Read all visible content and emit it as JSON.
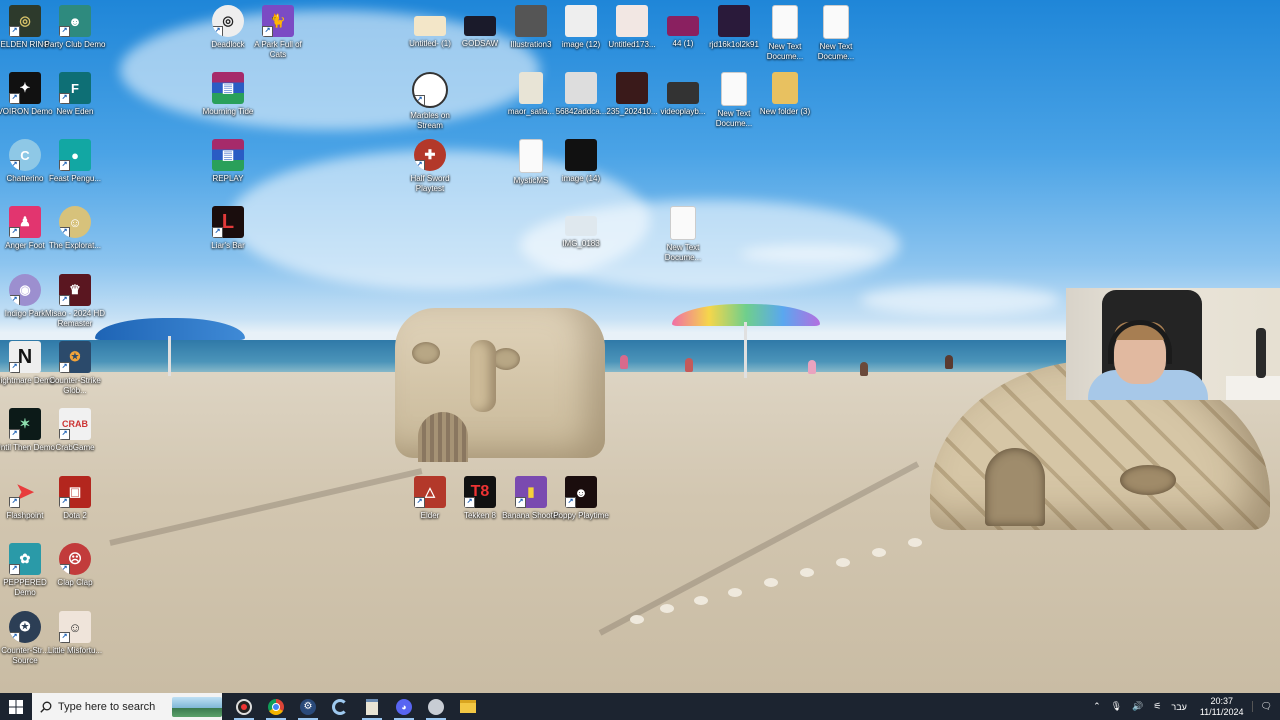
{
  "desktop": {
    "icons": [
      {
        "label": "ELDEN RING",
        "icon": "elden-ring-icon"
      },
      {
        "label": "Party Club Demo",
        "icon": "party-club-icon"
      },
      {
        "label": "VOIRON Demo",
        "icon": "voiron-icon"
      },
      {
        "label": "New Eden",
        "icon": "new-eden-icon"
      },
      {
        "label": "Chatterino",
        "icon": "chatterino-icon"
      },
      {
        "label": "Feast Pengu...",
        "icon": "feast-penguin-icon"
      },
      {
        "label": "Anger Foot",
        "icon": "anger-foot-icon"
      },
      {
        "label": "The Explorat...",
        "icon": "exploration-icon"
      },
      {
        "label": "Indigo Park",
        "icon": "indigo-park-icon"
      },
      {
        "label": "Misao - 2024 HD Remaster",
        "icon": "misao-icon"
      },
      {
        "label": "Nightmare Demo",
        "icon": "nightmare-demo-icon"
      },
      {
        "label": "Counter-Strike Glob...",
        "icon": "counter-strike-go-icon"
      },
      {
        "label": "Until Then Demo",
        "icon": "until-then-icon"
      },
      {
        "label": "CrabGame",
        "icon": "crab-game-icon"
      },
      {
        "label": "Flashpoint",
        "icon": "flashpoint-icon"
      },
      {
        "label": "Dota 2",
        "icon": "dota2-icon"
      },
      {
        "label": "PEPPERED Demo",
        "icon": "peppered-icon"
      },
      {
        "label": "Clap Clap",
        "icon": "clap-clap-icon"
      },
      {
        "label": "Counter-Str... Source",
        "icon": "counter-strike-source-icon"
      },
      {
        "label": "Little Misfortu...",
        "icon": "little-misfortune-icon"
      },
      {
        "label": "Deadlock",
        "icon": "deadlock-icon"
      },
      {
        "label": "A Park Full of Cats",
        "icon": "park-full-of-cats-icon"
      },
      {
        "label": "Mourning Tide",
        "icon": "winrar-archive-icon"
      },
      {
        "label": "REPLAY",
        "icon": "winrar-archive-icon"
      },
      {
        "label": "Liar's Bar",
        "icon": "liars-bar-icon"
      },
      {
        "label": "Untitled- (1)",
        "icon": "image-file-icon"
      },
      {
        "label": "GODSAW",
        "icon": "image-file-icon"
      },
      {
        "label": "Illustration3",
        "icon": "image-file-icon"
      },
      {
        "label": "image (12)",
        "icon": "image-file-icon"
      },
      {
        "label": "Untitled173...",
        "icon": "image-file-icon"
      },
      {
        "label": "44 (1)",
        "icon": "image-file-icon"
      },
      {
        "label": "rjd16k1ol2k91",
        "icon": "image-file-icon"
      },
      {
        "label": "New Text Docume...",
        "icon": "text-document-icon"
      },
      {
        "label": "New Text Docume...",
        "icon": "text-document-icon"
      },
      {
        "label": "Marbles on Stream",
        "icon": "marbles-on-stream-icon"
      },
      {
        "label": "maor_satla...",
        "icon": "image-file-icon"
      },
      {
        "label": "56842addca...",
        "icon": "image-file-icon"
      },
      {
        "label": "235_202410...",
        "icon": "image-file-icon"
      },
      {
        "label": "videoplayb...",
        "icon": "video-file-icon"
      },
      {
        "label": "New Text Docume...",
        "icon": "text-document-icon"
      },
      {
        "label": "New folder (3)",
        "icon": "folder-icon"
      },
      {
        "label": "Half Sword Playtest",
        "icon": "half-sword-icon"
      },
      {
        "label": "MysticMS",
        "icon": "blank-file-icon"
      },
      {
        "label": "image (14)",
        "icon": "image-file-icon"
      },
      {
        "label": "IMG_0183",
        "icon": "image-file-icon"
      },
      {
        "label": "New Text Docume...",
        "icon": "text-document-icon"
      },
      {
        "label": "Elder",
        "icon": "game-icon"
      },
      {
        "label": "Tekken 8",
        "icon": "tekken8-icon"
      },
      {
        "label": "Banana Shooter",
        "icon": "game-icon"
      },
      {
        "label": "Poppy Playtime",
        "icon": "game-icon"
      }
    ]
  },
  "taskbar": {
    "search_placeholder": "Type here to search",
    "apps": [
      "obs-icon",
      "chrome-icon",
      "steam-icon",
      "ccleaner-icon",
      "notepad-icon",
      "discord-icon",
      "app-icon",
      "file-explorer-icon"
    ],
    "tray": {
      "language": "עבר",
      "time": "20:37",
      "date": "11/11/2024"
    }
  }
}
